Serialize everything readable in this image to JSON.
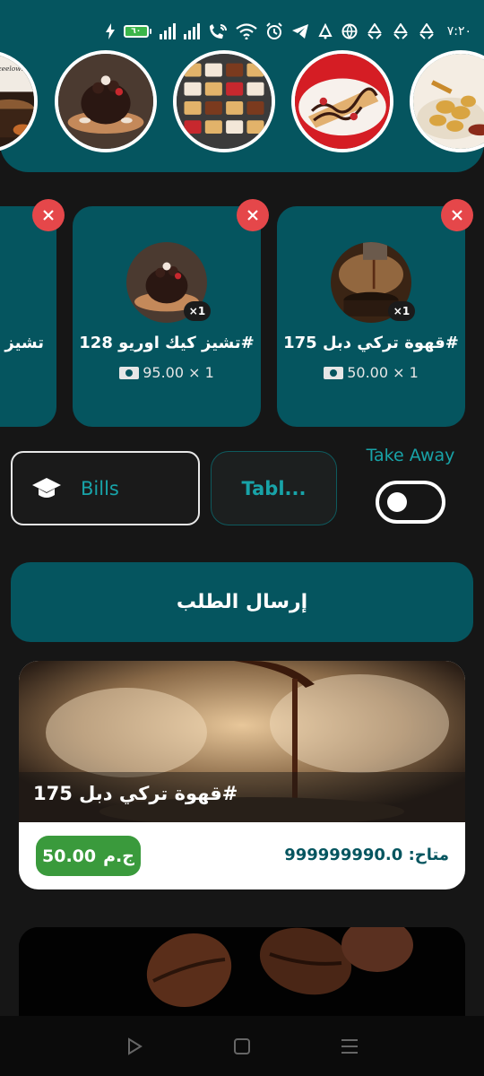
{
  "status_bar": {
    "time": "٧:٢٠",
    "battery_level": "٦٠",
    "icons": [
      "flash-icon",
      "battery-icon",
      "signal-icon",
      "signal-icon",
      "wifi-calling-icon",
      "wifi-icon",
      "alarm-icon",
      "telegram-icon",
      "notification-icon",
      "vpn-icon",
      "sync-icon",
      "sync-icon",
      "sync-icon"
    ]
  },
  "categories": [
    {
      "name": "coffee",
      "caption": "zeelow…"
    },
    {
      "name": "cheesecake"
    },
    {
      "name": "waffles"
    },
    {
      "name": "crepe"
    },
    {
      "name": "fries"
    }
  ],
  "cart": {
    "items": [
      {
        "name": "تشيز",
        "price": "",
        "qty_badge": ""
      },
      {
        "name": "تشيز كيك اوريو 128#",
        "price": "95.00 × 1",
        "qty_badge": "×1"
      },
      {
        "name": "قهوة تركي دبل 175#",
        "price": "50.00 × 1",
        "qty_badge": "×1"
      }
    ]
  },
  "controls": {
    "bills_label": "Bills",
    "tables_label": "Tabl...",
    "take_away_label": "Take Away",
    "take_away_on": false
  },
  "submit": {
    "label": "إرسال الطلب"
  },
  "products": [
    {
      "name": "قهوة تركي دبل 175#",
      "price_value": "50.00",
      "currency": "ج.م",
      "availability": "متاح: 999999990.0"
    }
  ],
  "colors": {
    "teal": "#05555f",
    "accent_text": "#18a3a8",
    "remove_red": "#e5474a",
    "price_green": "#3a9a3c",
    "background": "#161616"
  }
}
